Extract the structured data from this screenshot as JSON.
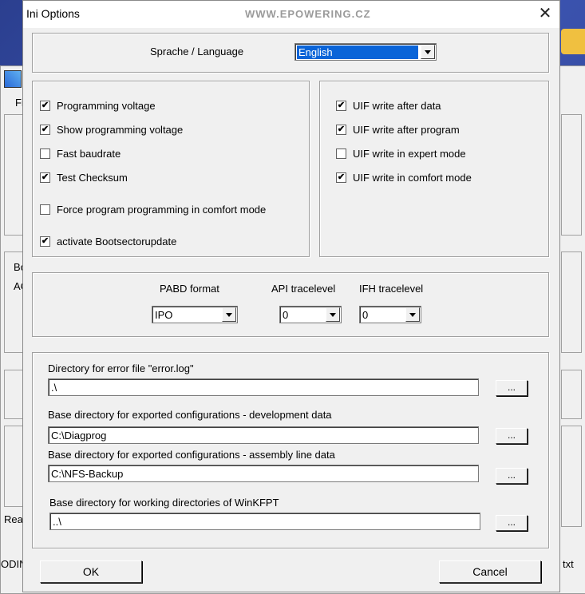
{
  "background": {
    "bg_labels": [
      "Fi",
      "Bo",
      "AC",
      "Rea",
      "ODIN",
      "txt"
    ]
  },
  "dialog": {
    "title": "Ini Options",
    "watermark": "WWW.EPOWERING.CZ",
    "close_glyph": "✕"
  },
  "language": {
    "label": "Sprache / Language",
    "selected": "English"
  },
  "left_checks": [
    {
      "label": "Programming voltage",
      "checked": true
    },
    {
      "label": "Show programming voltage",
      "checked": true
    },
    {
      "label": "Fast baudrate",
      "checked": false
    },
    {
      "label": "Test Checksum",
      "checked": true
    },
    {
      "label": "Force program programming in comfort mode",
      "checked": false
    },
    {
      "label": "activate Bootsectorupdate",
      "checked": true
    }
  ],
  "right_checks": [
    {
      "label": "UIF write after data",
      "checked": true
    },
    {
      "label": "UIF write after program",
      "checked": true
    },
    {
      "label": "UIF write in expert mode",
      "checked": false
    },
    {
      "label": "UIF write in comfort mode",
      "checked": true
    }
  ],
  "formats": {
    "pabd_label": "PABD format",
    "pabd_value": "IPO",
    "api_label": "API tracelevel",
    "api_value": "0",
    "ifh_label": "IFH tracelevel",
    "ifh_value": "0"
  },
  "directories": [
    {
      "label": "Directory for error file \"error.log\"",
      "value": ".\\",
      "browse": "..."
    },
    {
      "label": "Base directory for exported configurations - development data",
      "value": "C:\\Diagprog",
      "browse": "..."
    },
    {
      "label": "Base directory for exported configurations - assembly line data",
      "value": "C:\\NFS-Backup",
      "browse": "..."
    },
    {
      "label": "Base directory for working directories of WinKFPT",
      "value": "..\\",
      "browse": "..."
    }
  ],
  "buttons": {
    "ok": "OK",
    "cancel": "Cancel"
  },
  "check_glyph": "✔"
}
